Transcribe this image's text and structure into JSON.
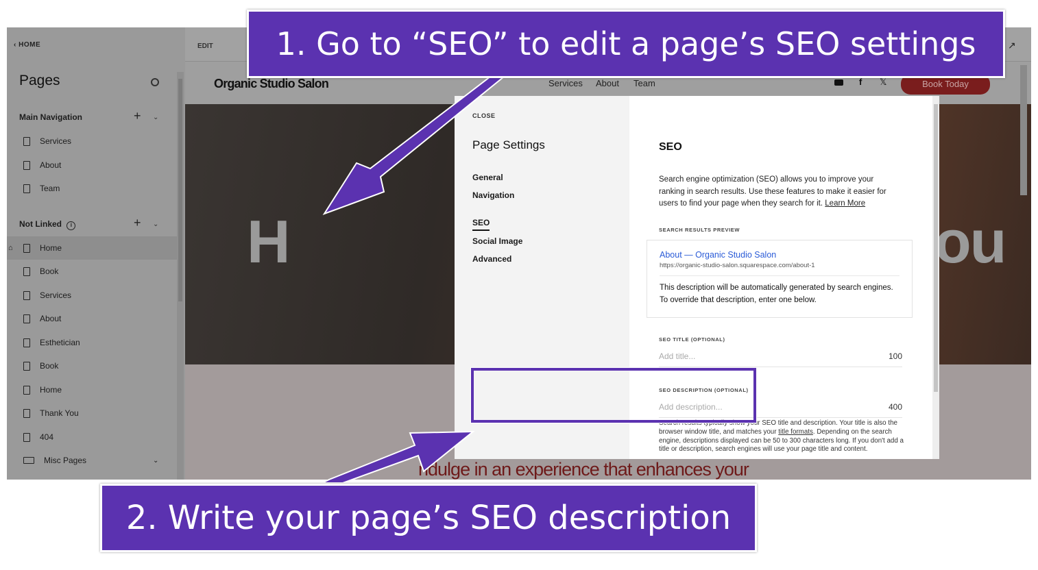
{
  "sidebar": {
    "back_label": "HOME",
    "title": "Pages",
    "main_nav": {
      "label": "Main Navigation",
      "items": [
        "Services",
        "About",
        "Team"
      ]
    },
    "not_linked": {
      "label": "Not Linked",
      "items": [
        "Home",
        "Book",
        "Services",
        "About",
        "Esthetician",
        "Book",
        "Home",
        "Thank You",
        "404",
        "Misc Pages"
      ]
    }
  },
  "preview": {
    "edit_label": "EDIT",
    "site_logo": "Organic Studio Salon",
    "nav": [
      "Services",
      "About",
      "Team"
    ],
    "book_button": "Book Today",
    "hero_text": "With You",
    "hero_left": "H",
    "tagline": "ndulge in an experience that enhances your"
  },
  "modal": {
    "close": "CLOSE",
    "title": "Page Settings",
    "nav": [
      "General",
      "Navigation",
      "SEO",
      "Social Image",
      "Advanced"
    ],
    "selected": "SEO",
    "seo": {
      "heading": "SEO",
      "intro": "Search engine optimization (SEO) allows you to improve your ranking in search results. Use these features to make it easier for users to find your page when they search for it.",
      "learn_more": "Learn More",
      "preview_label": "SEARCH RESULTS PREVIEW",
      "preview_title": "About — Organic Studio Salon",
      "preview_url": "https://organic-studio-salon.squarespace.com/about-1",
      "preview_desc": "This description will be automatically generated by search engines. To override that description, enter one below.",
      "title_label": "SEO TITLE (OPTIONAL)",
      "title_placeholder": "Add title...",
      "title_count": "100",
      "desc_label": "SEO DESCRIPTION (OPTIONAL)",
      "desc_placeholder": "Add description...",
      "desc_count": "400",
      "help_1": "Search results typically show your SEO title and description. Your title is also the browser window title, and matches your",
      "help_link": "title formats",
      "help_2": ". Depending on the search engine, descriptions displayed can be 50 to 300 characters long. If you don't add a title or description, search engines will use your page title and content."
    }
  },
  "callouts": {
    "step1": "1.  Go to “SEO” to edit a page’s SEO settings",
    "step2": "2. Write your page’s SEO description"
  },
  "colors": {
    "accent": "#5b32b0",
    "link": "#2a5bd7",
    "book_button": "#7a1d1d"
  }
}
